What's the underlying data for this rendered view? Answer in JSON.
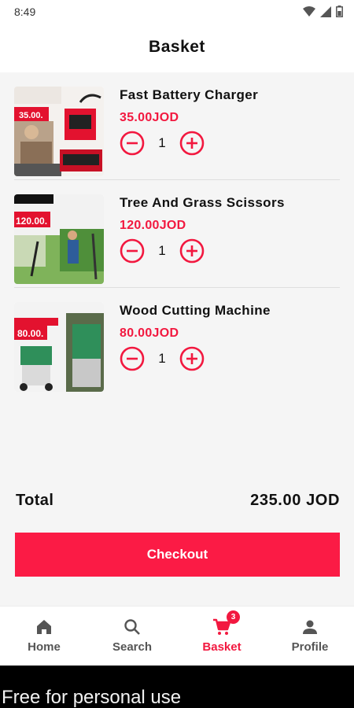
{
  "status_bar": {
    "time": "8:49",
    "icons": [
      "wifi-icon",
      "signal-icon",
      "battery-icon"
    ]
  },
  "header": {
    "title": "Basket"
  },
  "basket": {
    "items": [
      {
        "name": "Fast Battery Charger",
        "price": "35.00JOD",
        "quantity": "1",
        "image_tag": "35.00."
      },
      {
        "name": "Tree And Grass Scissors",
        "price": "120.00JOD",
        "quantity": "1",
        "image_tag": "120.00."
      },
      {
        "name": "Wood Cutting Machine",
        "price": "80.00JOD",
        "quantity": "1",
        "image_tag": "80.00."
      }
    ]
  },
  "summary": {
    "total_label": "Total",
    "total_value": "235.00 JOD",
    "checkout_label": "Checkout"
  },
  "nav": {
    "items": [
      {
        "label": "Home",
        "icon": "home-icon"
      },
      {
        "label": "Search",
        "icon": "search-icon"
      },
      {
        "label": "Basket",
        "icon": "cart-icon",
        "badge": "3"
      },
      {
        "label": "Profile",
        "icon": "person-icon"
      }
    ]
  },
  "watermark": {
    "text": "Free for personal use"
  },
  "colors": {
    "accent": "#f2183f",
    "button": "#fb1b45"
  }
}
